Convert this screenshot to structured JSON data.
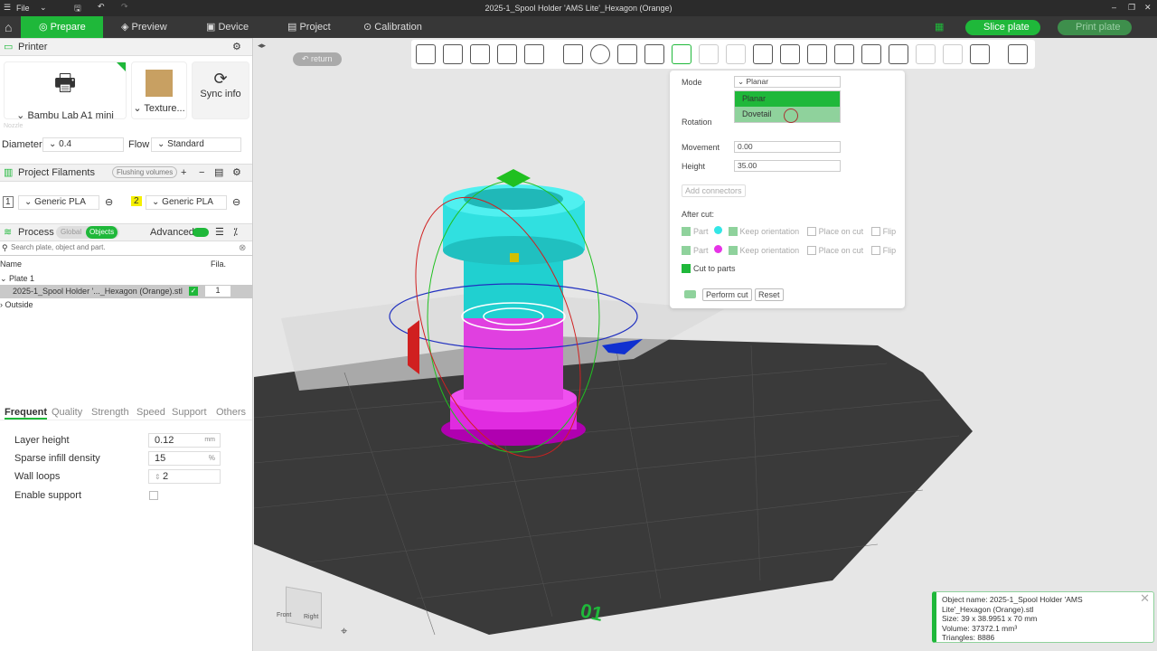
{
  "titlebar": {
    "menu": "File",
    "title": "2025-1_Spool Holder 'AMS Lite'_Hexagon (Orange)"
  },
  "tabs": [
    {
      "label": "Prepare"
    },
    {
      "label": "Preview"
    },
    {
      "label": "Device"
    },
    {
      "label": "Project"
    },
    {
      "label": "Calibration"
    }
  ],
  "actions": {
    "slice": "Slice plate",
    "print": "Print plate"
  },
  "printer": {
    "section": "Printer",
    "name": "Bambu Lab A1 mini",
    "plate": "Texture...",
    "sync": "Sync info",
    "nozzle_label": "Nozzle",
    "diameter_label": "Diameter",
    "diameter": "0.4",
    "flow_label": "Flow",
    "flow": "Standard"
  },
  "filaments": {
    "section": "Project Filaments",
    "flushing": "Flushing volumes",
    "items": [
      {
        "num": "1",
        "name": "Generic PLA"
      },
      {
        "num": "2",
        "name": "Generic PLA"
      }
    ]
  },
  "process": {
    "section": "Process",
    "global": "Global",
    "objects": "Objects",
    "advanced": "Advanced",
    "search_placeholder": "Search plate, object and part.",
    "col_name": "Name",
    "col_fila": "Fila.",
    "plate": "Plate 1",
    "object": "2025-1_Spool Holder '..._Hexagon (Orange).stl",
    "object_fila": "1",
    "outside": "Outside"
  },
  "settings": {
    "tabs": [
      "Frequent",
      "Quality",
      "Strength",
      "Speed",
      "Support",
      "Others"
    ],
    "rows": [
      {
        "label": "Layer height",
        "value": "0.12",
        "unit": "mm"
      },
      {
        "label": "Sparse infill density",
        "value": "15",
        "unit": "%"
      },
      {
        "label": "Wall loops",
        "value": "2",
        "unit": ""
      }
    ],
    "support_label": "Enable support"
  },
  "viewport": {
    "return": "return",
    "plate_number": "01"
  },
  "cut": {
    "mode_label": "Mode",
    "mode": "Planar",
    "options": [
      "Planar",
      "Dovetail"
    ],
    "rotation_label": "Rotation",
    "movement_label": "Movement",
    "movement": "0.00",
    "height_label": "Height",
    "height": "35.00",
    "add_connectors": "Add connectors",
    "after_cut": "After cut:",
    "part": "Part",
    "keep_orientation": "Keep orientation",
    "place_on_cut": "Place on cut",
    "flip": "Flip",
    "cut_to_parts": "Cut to parts",
    "perform": "Perform cut",
    "reset": "Reset",
    "colors": {
      "upper": "#33e6e6",
      "lower": "#e633e6"
    }
  },
  "info": {
    "line1": "Object name: 2025-1_Spool Holder 'AMS",
    "line2": "Lite'_Hexagon (Orange).stl",
    "line3": "Size: 39 x 38.9951 x 70 mm",
    "line4": "Volume: 37372.1 mm³",
    "line5": "Triangles: 8886"
  },
  "cube": {
    "front": "Front",
    "right": "Right"
  }
}
